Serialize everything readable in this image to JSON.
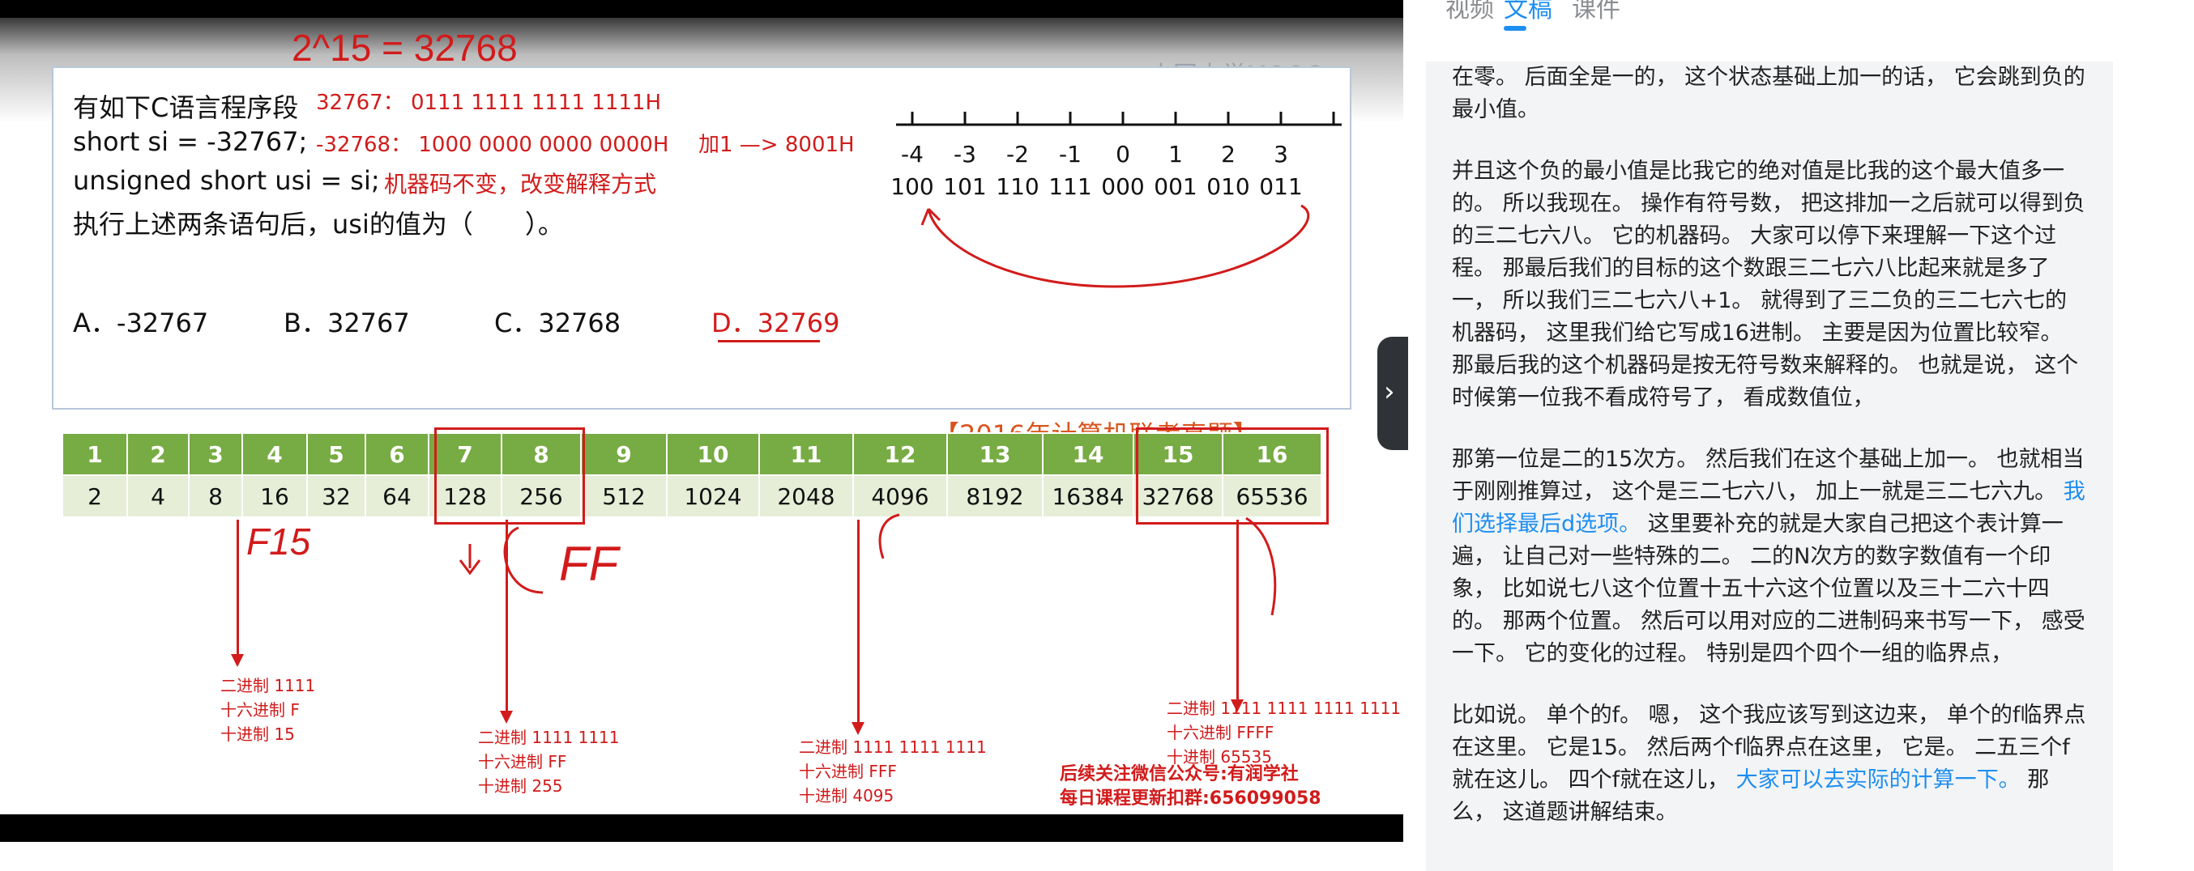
{
  "slide": {
    "handwriting_top": "2^15 = 32768",
    "watermark": "中国大学MOOC",
    "question_line1": "有如下C语言程序段",
    "question_line2": "short si = -32767;",
    "question_line3": "unsigned short usi = si;",
    "question_line4": "执行上述两条语句后，usi的值为（　　）。",
    "note_32767": "32767： 0111 1111 1111 1111H",
    "note_neg32768": "-32768： 1000 0000 0000 0000H",
    "note_add1": "加1 —> 8001H",
    "note_machine_code": "机器码不变，改变解释方式",
    "options": [
      "A．-32767",
      "B．32767",
      "C．32768",
      "D．32769"
    ],
    "exam_source": "【2016年计算机联考真题】",
    "number_line_labels": [
      "-4",
      "-3",
      "-2",
      "-1",
      "0",
      "1",
      "2",
      "3"
    ],
    "number_line_binary": [
      "100",
      "101",
      "110",
      "111",
      "000",
      "001",
      "010",
      "011"
    ],
    "power_row": [
      "1",
      "2",
      "3",
      "4",
      "5",
      "6",
      "7",
      "8",
      "9",
      "10",
      "11",
      "12",
      "13",
      "14",
      "15",
      "16"
    ],
    "value_row": [
      "2",
      "4",
      "8",
      "16",
      "32",
      "64",
      "128",
      "256",
      "512",
      "1024",
      "2048",
      "4096",
      "8192",
      "16384",
      "32768",
      "65536"
    ],
    "handwriting_f15": "F15",
    "handwriting_ff": "FF",
    "annotations": [
      {
        "lines": [
          "二进制 1111",
          "十六进制 F",
          "十进制 15"
        ]
      },
      {
        "lines": [
          "二进制 1111 1111",
          "十六进制 FF",
          "十进制 255"
        ]
      },
      {
        "lines": [
          "二进制 1111 1111 1111",
          "十六进制 FFF",
          "十进制 4095"
        ]
      },
      {
        "lines": [
          "二进制 1111 1111 1111 1111",
          "十六进制 FFFF",
          "十进制 65535"
        ]
      }
    ],
    "footer_line1": "后续关注微信公众号:有润学社",
    "footer_line2": "每日课程更新扣群:656099058"
  },
  "panel": {
    "tabs": [
      "视频",
      "文稿",
      "课件"
    ],
    "active_tab": "文稿",
    "paragraphs": [
      [
        {
          "t": "在零。 后面全是一的， 这个状态基础上加一的话， 它会跳到负的最小值。"
        }
      ],
      [
        {
          "t": "并且这个负的最小值是比我它的绝对值是比我的这个最大值多一的。 所以我现在。 操作有符号数， 把这排加一之后就可以得到负的三二七六八。 它的机器码。 大家可以停下来理解一下这个过程。 那最后我们的目标的这个数跟三二七六八比起来就是多了一， 所以我们三二七六八+1。 就得到了三二负的三二七六七的机器码， 这里我们给它写成16进制。 主要是因为位置比较窄。 那最后我的这个机器码是按无符号数来解释的。 也就是说， 这个时候第一位我不看成符号了， 看成数值位，"
        }
      ],
      [
        {
          "t": "那第一位是二的15次方。 然后我们在这个基础上加一。 也就相当于刚刚推算过， 这个是三二七六八， 加上一就是三二七六九。 "
        },
        {
          "t": "我们选择最后d选项。",
          "hl": true
        },
        {
          "t": " 这里要补充的就是大家自己把这个表计算一遍， 让自己对一些特殊的二。 二的N次方的数字数值有一个印象， 比如说七八这个位置十五十六这个位置以及三十二六十四的。 那两个位置。 然后可以用对应的二进制码来书写一下， 感受一下。 它的变化的过程。 特别是四个四个一组的临界点，"
        }
      ],
      [
        {
          "t": "比如说。 单个的f。 嗯， 这个我应该写到这边来， 单个的f临界点在这里。 它是15。 然后两个f临界点在这里， 它是。 二五三个f就在这儿。 四个f就在这儿， "
        },
        {
          "t": "大家可以去实际的计算一下。",
          "hl": true
        },
        {
          "t": " 那么， 这道题讲解结束。"
        }
      ]
    ]
  }
}
